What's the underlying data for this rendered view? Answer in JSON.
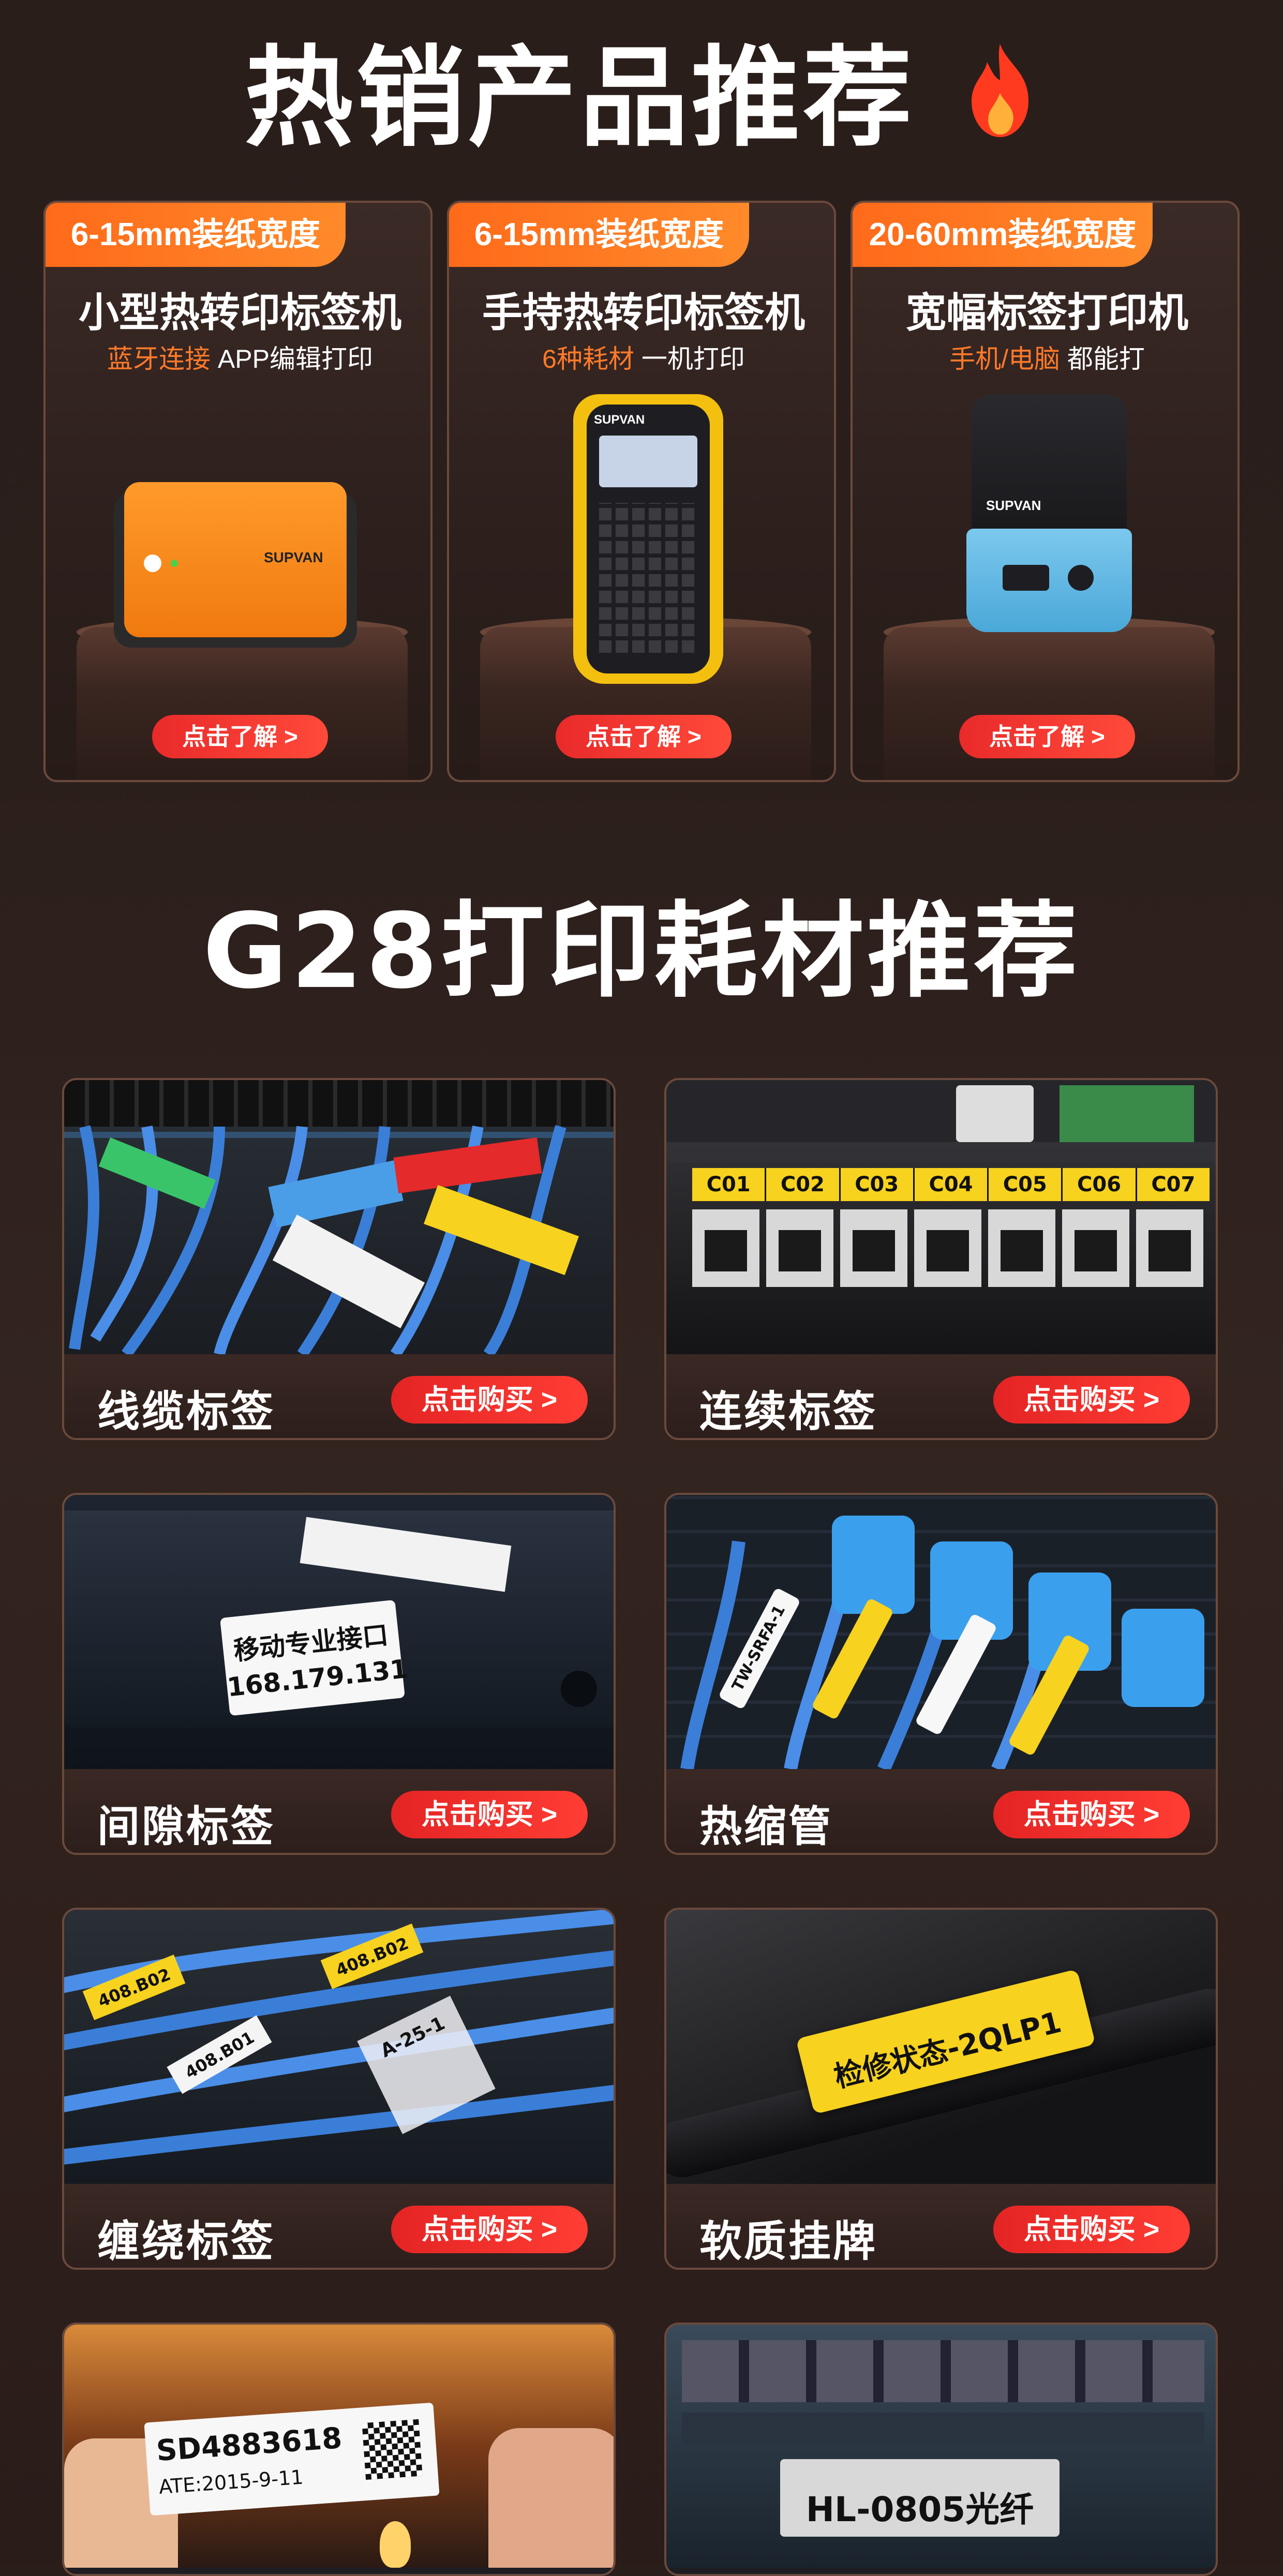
{
  "section1": {
    "title": "热销产品推荐"
  },
  "products": [
    {
      "tag": "6-15mm装纸宽度",
      "name": "小型热转印标签机",
      "sub_highlight": "蓝牙连接",
      "sub_rest": " APP编辑打印",
      "button": "点击了解 >",
      "brand": "SUPVAN"
    },
    {
      "tag": "6-15mm装纸宽度",
      "name": "手持热转印标签机",
      "sub_highlight": "6种耗材",
      "sub_rest": " 一机打印",
      "button": "点击了解 >",
      "brand": "SUPVAN"
    },
    {
      "tag": "20-60mm装纸宽度",
      "name": "宽幅标签打印机",
      "sub_highlight": "手机/电脑",
      "sub_rest": " 都能打",
      "button": "点击了解 >",
      "brand": "SUPVAN"
    }
  ],
  "section2": {
    "title": "G28打印耗材推荐"
  },
  "materials": [
    {
      "label": "线缆标签",
      "button": "点击购买 >"
    },
    {
      "label": "连续标签",
      "button": "点击购买 >",
      "ports": [
        "C01",
        "C02",
        "C03",
        "C04",
        "C05",
        "C06",
        "C07"
      ]
    },
    {
      "label": "间隙标签",
      "button": "点击购买 >",
      "sample_line1": "移动专业接口",
      "sample_line2": "168.179.131"
    },
    {
      "label": "热缩管",
      "button": "点击购买 >",
      "sample": "TW-SRFA-1"
    },
    {
      "label": "缠绕标签",
      "button": "点击购买 >",
      "sample1": "408.B02",
      "sample2": "408.B01",
      "sample3": "A-25-1"
    },
    {
      "label": "软质挂牌",
      "button": "点击购买 >",
      "sample": "检修状态-2QLP1"
    },
    {
      "sample1": "SD4883618",
      "sample2": "ATE:2015-9-11"
    },
    {
      "sample": "HL-0805光纤"
    }
  ],
  "colors": {
    "accent_orange": "#ff7a2a",
    "button_red": "#ee2f2f",
    "label_yellow": "#f7d21e"
  }
}
